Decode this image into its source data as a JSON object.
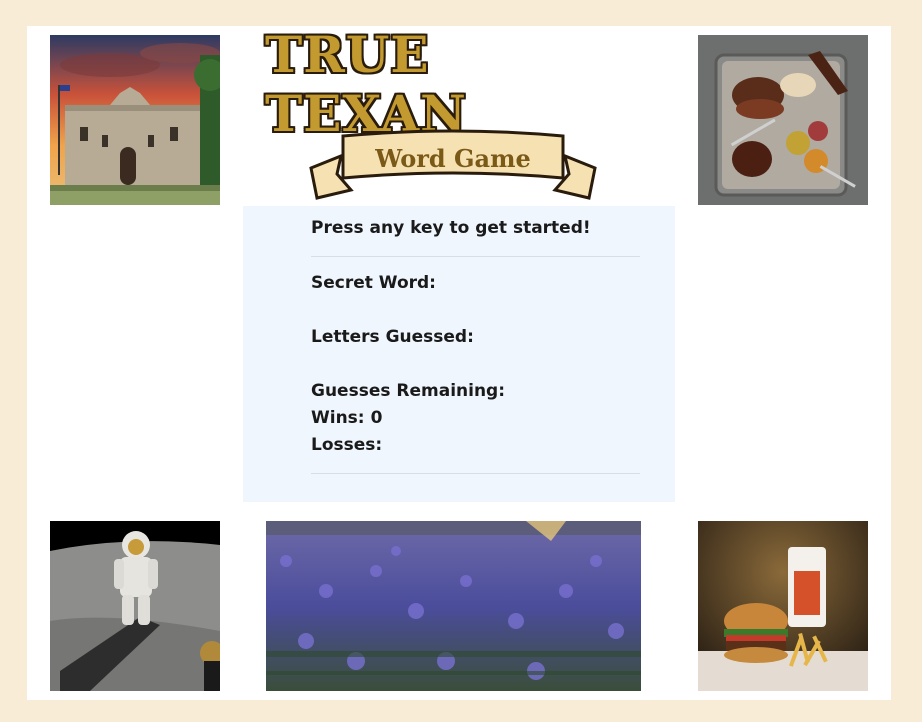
{
  "logo": {
    "title": "TRUE TEXAN",
    "subtitle": "Word Game"
  },
  "game": {
    "prompt": "Press any key to get started!",
    "secret_word_label": "Secret Word:",
    "secret_word_value": "",
    "letters_guessed_label": "Letters Guessed:",
    "letters_guessed_value": "",
    "guesses_remaining_label": "Guesses Remaining:",
    "guesses_remaining_value": "",
    "wins_label": "Wins:",
    "wins_value": "0",
    "losses_label": "Losses:",
    "losses_value": ""
  },
  "colors": {
    "page_background": "#f9ecd6",
    "panel_background": "#f0f6fd",
    "logo_gold": "#c39a2f",
    "logo_outline": "#2a1c0c",
    "banner_fill": "#f6e1b3"
  },
  "images": [
    "alamo-photo",
    "bbq-platter-photo",
    "moon-astronaut-photo",
    "bluebonnet-field-photo",
    "burger-and-fries-photo"
  ]
}
